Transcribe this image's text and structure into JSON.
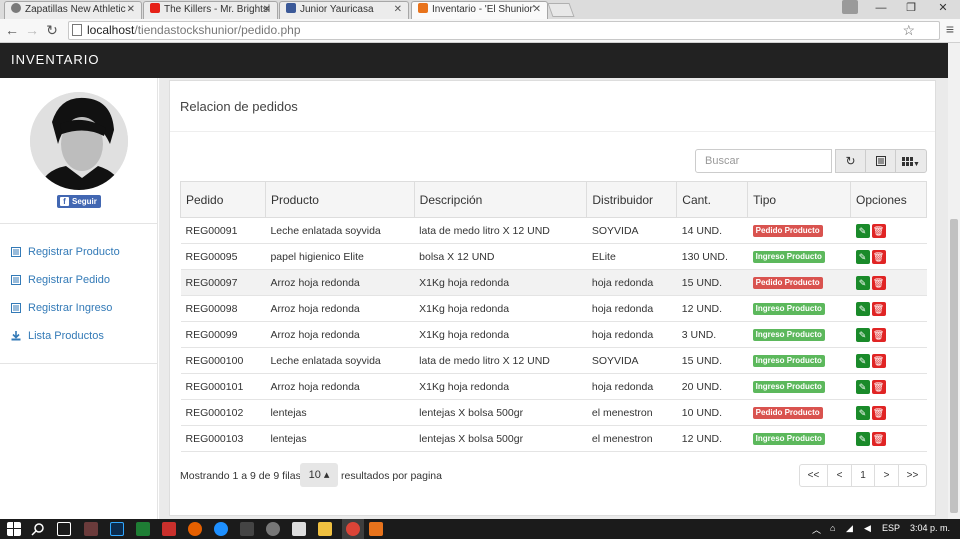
{
  "browser": {
    "tabs": [
      {
        "title": "Zapatillas New Athletic - ",
        "active": false,
        "favicon_color": "#7a7a7a"
      },
      {
        "title": "The Killers - Mr. Brightsi",
        "active": false,
        "favicon_color": "#e62117"
      },
      {
        "title": "Junior Yauricasa",
        "active": false,
        "favicon_color": "#3b5998"
      },
      {
        "title": "Inventario - 'El Shunior'",
        "active": true,
        "favicon_color": "#e8731c"
      }
    ],
    "url_host": "localhost",
    "url_path": "/tiendastockshunior/pedido.php",
    "window_controls": {
      "minimize": "—",
      "maximize": "❐",
      "close": "✕"
    }
  },
  "app": {
    "brand": "INVENTARIO"
  },
  "sidebar": {
    "follow_label": "Seguir",
    "items": [
      {
        "label": "Registrar Producto",
        "icon": "list-icon"
      },
      {
        "label": "Registrar Pedido",
        "icon": "list-icon"
      },
      {
        "label": "Registrar Ingreso",
        "icon": "list-icon"
      },
      {
        "label": "Lista Productos",
        "icon": "download-icon"
      }
    ]
  },
  "panel": {
    "title": "Relacion de pedidos",
    "search_placeholder": "Buscar",
    "columns": [
      "Pedido",
      "Producto",
      "Descripción",
      "Distribuidor",
      "Cant.",
      "Tipo",
      "Opciones"
    ],
    "rows": [
      {
        "pedido": "REG00091",
        "producto": "Leche enlatada soyvida",
        "descripcion": "lata de medo litro X 12 UND",
        "distribuidor": "SOYVIDA",
        "cant": "14 UND.",
        "tipo": "Pedido Producto",
        "tipo_color": "red"
      },
      {
        "pedido": "REG00095",
        "producto": "papel higienico Elite",
        "descripcion": "bolsa X 12 UND",
        "distribuidor": "ELite",
        "cant": "130 UND.",
        "tipo": "Ingreso Producto",
        "tipo_color": "green"
      },
      {
        "pedido": "REG00097",
        "producto": "Arroz hoja redonda",
        "descripcion": "X1Kg hoja redonda",
        "distribuidor": "hoja redonda",
        "cant": "15 UND.",
        "tipo": "Pedido Producto",
        "tipo_color": "red"
      },
      {
        "pedido": "REG00098",
        "producto": "Arroz hoja redonda",
        "descripcion": "X1Kg hoja redonda",
        "distribuidor": "hoja redonda",
        "cant": "12 UND.",
        "tipo": "Ingreso Producto",
        "tipo_color": "green"
      },
      {
        "pedido": "REG00099",
        "producto": "Arroz hoja redonda",
        "descripcion": "X1Kg hoja redonda",
        "distribuidor": "hoja redonda",
        "cant": "3 UND.",
        "tipo": "Ingreso Producto",
        "tipo_color": "green"
      },
      {
        "pedido": "REG000100",
        "producto": "Leche enlatada soyvida",
        "descripcion": "lata de medo litro X 12 UND",
        "distribuidor": "SOYVIDA",
        "cant": "15 UND.",
        "tipo": "Ingreso Producto",
        "tipo_color": "green"
      },
      {
        "pedido": "REG000101",
        "producto": "Arroz hoja redonda",
        "descripcion": "X1Kg hoja redonda",
        "distribuidor": "hoja redonda",
        "cant": "20 UND.",
        "tipo": "Ingreso Producto",
        "tipo_color": "green"
      },
      {
        "pedido": "REG000102",
        "producto": "lentejas",
        "descripcion": "lentejas X bolsa 500gr",
        "distribuidor": "el menestron",
        "cant": "10 UND.",
        "tipo": "Pedido Producto",
        "tipo_color": "red"
      },
      {
        "pedido": "REG000103",
        "producto": "lentejas",
        "descripcion": "lentejas X bolsa 500gr",
        "distribuidor": "el menestron",
        "cant": "12 UND.",
        "tipo": "Ingreso Producto",
        "tipo_color": "green"
      }
    ],
    "footer_prefix": "Mostrando 1 a 9 de 9 filas",
    "page_size": "10 ▴",
    "footer_suffix": "resultados por pagina",
    "pager": [
      "<<",
      "<",
      "1",
      ">",
      ">>"
    ]
  },
  "taskbar": {
    "language": "ESP",
    "clock": "3:04 p. m."
  }
}
